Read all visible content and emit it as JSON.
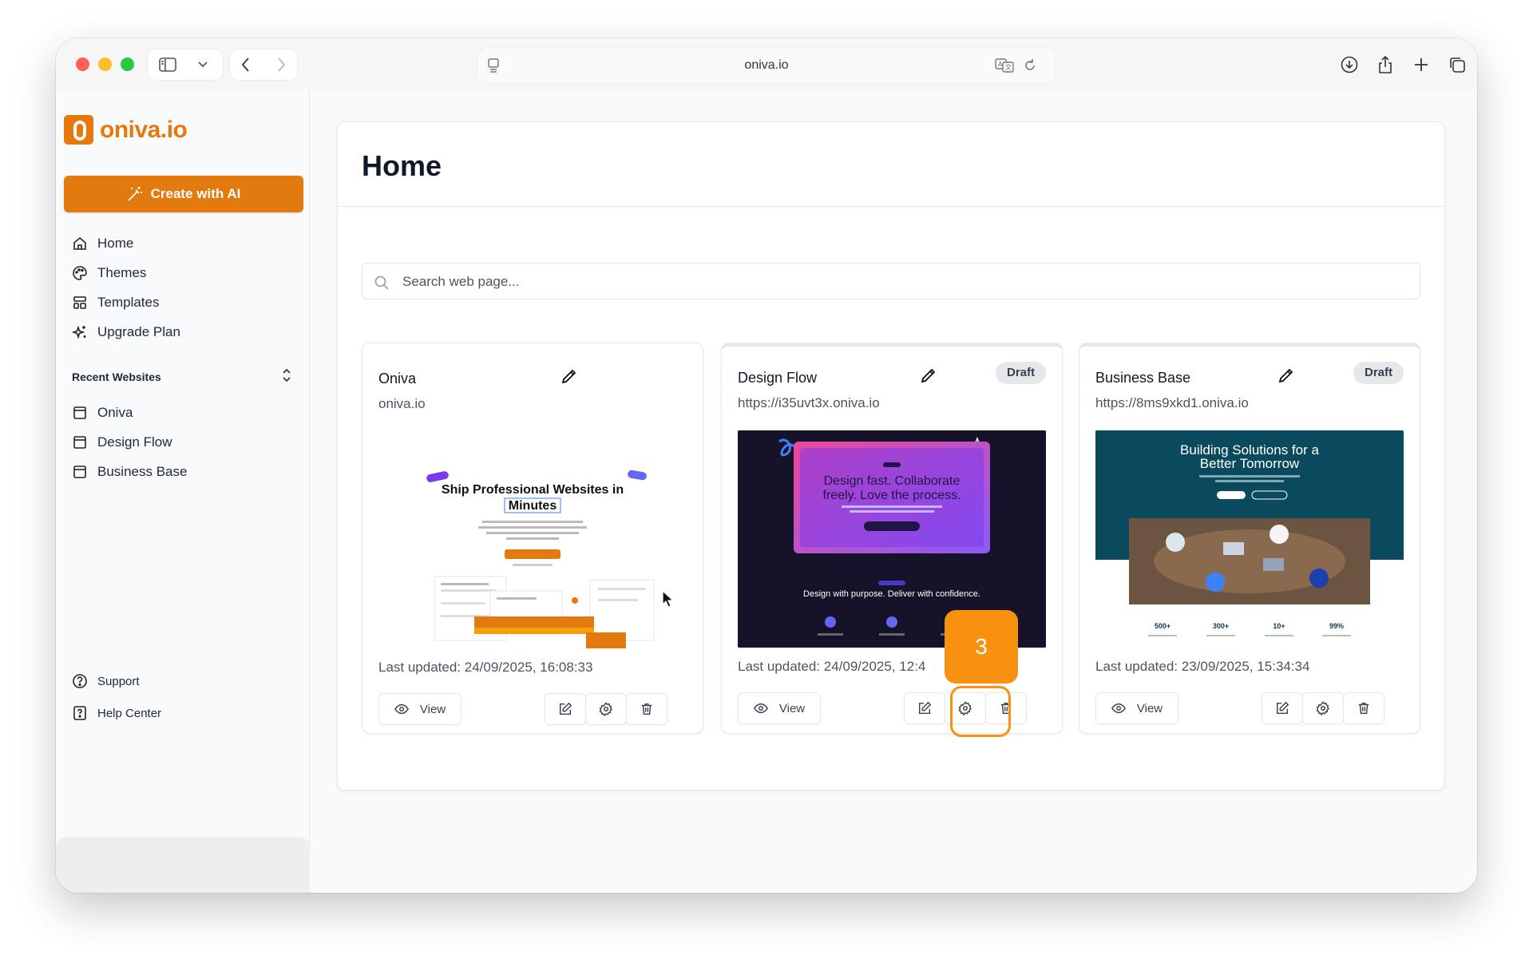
{
  "browser": {
    "url": "oniva.io"
  },
  "brand": {
    "name": "oniva.io",
    "accent": "#e27a10"
  },
  "sidebar": {
    "create_label": "Create with AI",
    "nav": [
      {
        "label": "Home",
        "icon": "home-icon"
      },
      {
        "label": "Themes",
        "icon": "palette-icon"
      },
      {
        "label": "Templates",
        "icon": "layout-icon"
      },
      {
        "label": "Upgrade Plan",
        "icon": "sparkles-icon"
      }
    ],
    "recent_label": "Recent Websites",
    "recent": [
      {
        "label": "Oniva"
      },
      {
        "label": "Design Flow"
      },
      {
        "label": "Business Base"
      }
    ],
    "footer": [
      {
        "label": "Support"
      },
      {
        "label": "Help Center"
      }
    ]
  },
  "main": {
    "title": "Home",
    "search_placeholder": "Search web page...",
    "cards": [
      {
        "name": "Oniva",
        "url": "oniva.io",
        "badge": "",
        "updated": "Last updated: 24/09/2025, 16:08:33",
        "view_label": "View",
        "thumb": {
          "headline_a": "Ship Professional Websites in",
          "headline_b": "Minutes"
        }
      },
      {
        "name": "Design Flow",
        "url": "https://i35uvt3x.oniva.io",
        "badge": "Draft",
        "updated": "Last updated: 24/09/2025, 12:4",
        "view_label": "View",
        "thumb": {
          "headline": "Design fast. Collaborate freely. Love the process.",
          "tagline": "Design with purpose. Deliver with confidence."
        }
      },
      {
        "name": "Business Base",
        "url": "https://8ms9xkd1.oniva.io",
        "badge": "Draft",
        "updated": "Last updated: 23/09/2025, 15:34:34",
        "view_label": "View",
        "thumb": {
          "headline": "Building Solutions for a Better Tomorrow",
          "stats": [
            "500+",
            "300+",
            "10+",
            "99%"
          ]
        }
      }
    ]
  },
  "overlay": {
    "step": "3"
  }
}
